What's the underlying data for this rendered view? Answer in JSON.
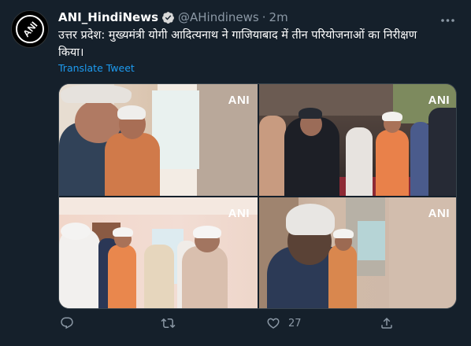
{
  "tweet": {
    "author_name": "ANI_HindiNews",
    "author_handle": "@AHindinews",
    "separator": "·",
    "time": "2m",
    "text": "उत्तर प्रदेश: मुख्यमंत्री योगी आदित्यनाथ ने गाजियाबाद में तीन परियोजनाओं का निरीक्षण किया।",
    "translate_label": "Translate Tweet",
    "more_icon": "more-icon",
    "avatar_logo_text": "ANI",
    "photos": [
      {
        "watermark": "ANI"
      },
      {
        "watermark": "ANI"
      },
      {
        "watermark": "ANI"
      },
      {
        "watermark": "ANI"
      }
    ],
    "actions": {
      "reply_icon": "reply-icon",
      "retweet_icon": "retweet-icon",
      "like_icon": "heart-icon",
      "like_count": "27",
      "share_icon": "share-icon"
    }
  },
  "colors": {
    "background": "#15202b",
    "accent": "#1d9bf0",
    "muted": "#8b98a5",
    "text": "#ffffff"
  }
}
